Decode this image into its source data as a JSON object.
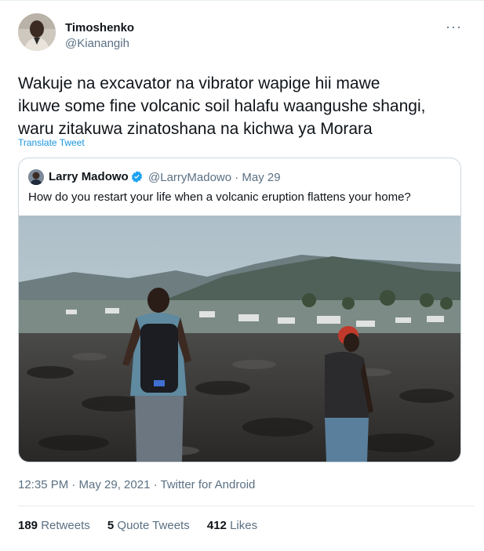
{
  "tweet": {
    "author_name": "Timoshenko",
    "author_handle": "@Kianangih",
    "more_icon": "more-horizontal-icon",
    "text_lines": [
      "Wakuje na excavator na vibrator wapige hii mawe",
      "ikuwe some fine volcanic soil halafu waangushe shangi,",
      "waru zitakuwa zinatoshana na kichwa ya Morara"
    ],
    "translate_label": "Translate Tweet",
    "timestamp": "12:35 PM · May 29, 2021 · Twitter for Android"
  },
  "quoted": {
    "author_name": "Larry Madowo",
    "verified_icon": "verified-badge-icon",
    "meta": "@LarryMadowo · May 29",
    "text": "How do you restart your life when a volcanic eruption flattens your home?"
  },
  "stats": [
    {
      "count": "189",
      "label": "Retweets"
    },
    {
      "count": "5",
      "label": "Quote Tweets"
    },
    {
      "count": "412",
      "label": "Likes"
    }
  ],
  "colors": {
    "link": "#1b95e0",
    "secondary_text": "#5b7083",
    "border": "#ccd6dd",
    "verified": "#1da1f2"
  }
}
